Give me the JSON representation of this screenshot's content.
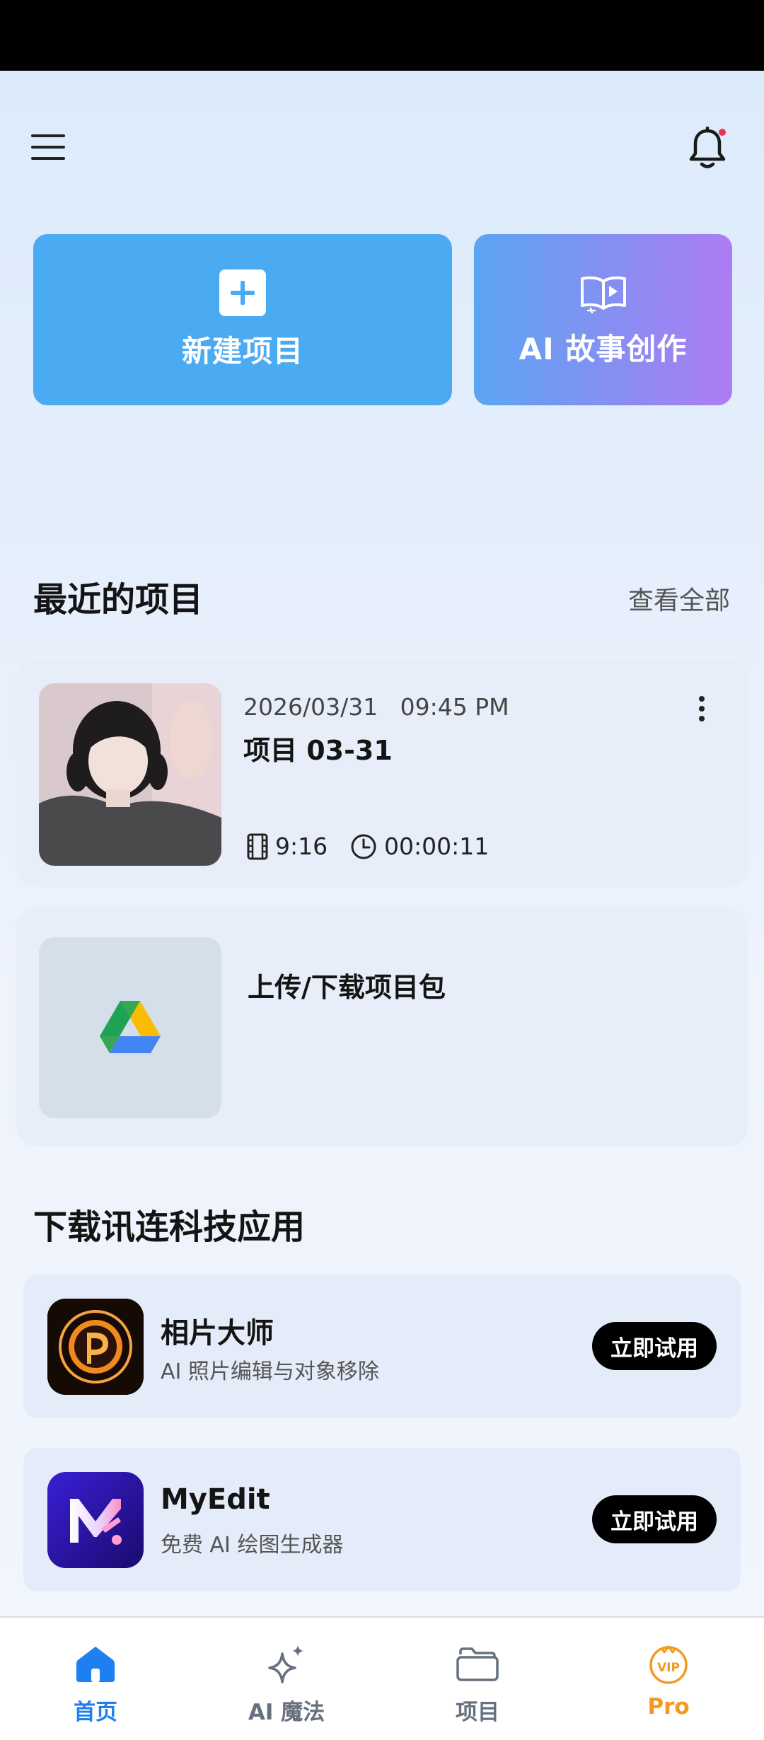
{
  "header": {
    "menu_icon": "hamburger-menu-icon",
    "bell_icon": "bell-icon",
    "has_notification": true
  },
  "actions": {
    "new_project": {
      "label": "新建项目",
      "icon": "plus-square-icon",
      "color": "#4aaaf2"
    },
    "ai_story": {
      "label": "AI 故事创作",
      "icon": "open-book-play-icon"
    }
  },
  "recent": {
    "title": "最近的项目",
    "view_all": "查看全部",
    "project": {
      "date": "2026/03/31   09:45 PM",
      "name": "项目 03-31",
      "ratio": "9:16",
      "duration": "00:00:11"
    },
    "upload": {
      "label": "上传/下载项目包",
      "icon": "google-drive-icon"
    }
  },
  "apps_section": {
    "title": "下载讯连科技应用",
    "apps": [
      {
        "name": "相片大师",
        "desc": "AI 照片编辑与对象移除",
        "button": "立即试用"
      },
      {
        "name": "MyEdit",
        "desc": "免费 AI 绘图生成器",
        "button": "立即试用"
      }
    ]
  },
  "nav": {
    "items": [
      {
        "label": "首页",
        "icon": "home-icon",
        "color": "#1e7ff0",
        "active": true
      },
      {
        "label": "AI 魔法",
        "icon": "sparkle-icon",
        "color": "#66707e"
      },
      {
        "label": "项目",
        "icon": "folder-icon",
        "color": "#66707e"
      },
      {
        "label": "Pro",
        "icon": "vip-crown-icon",
        "color": "#f29a1f"
      }
    ]
  }
}
